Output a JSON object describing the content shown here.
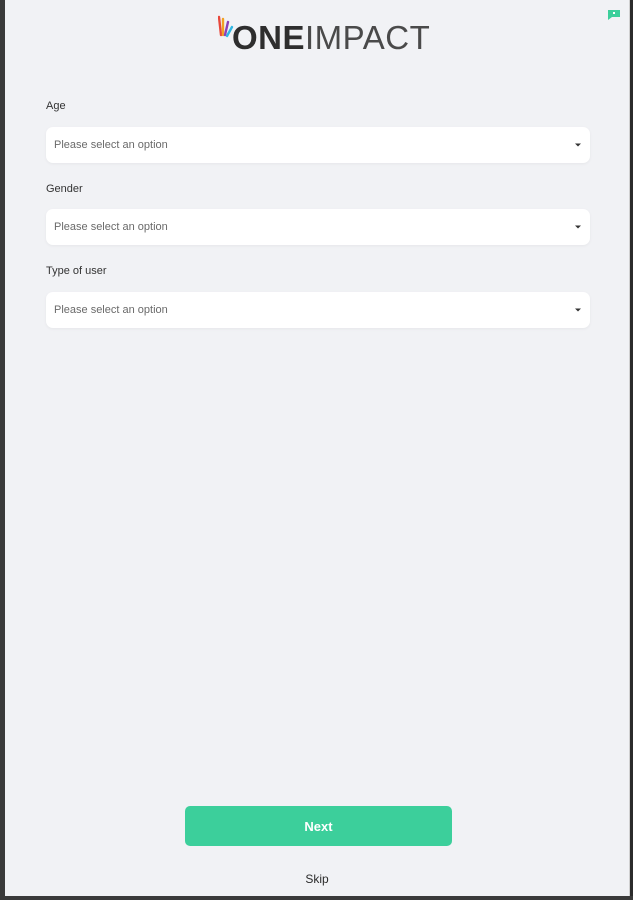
{
  "brand": {
    "logo_bold": "ONE",
    "logo_light": "IMPACT",
    "accent": "#3ccf9b"
  },
  "icons": {
    "logo_mark": "brand-feather-icon",
    "corner": "chat-flag-icon",
    "select_arrow": "caret-down-icon"
  },
  "form": {
    "fields": [
      {
        "label": "Age",
        "placeholder": "Please select an option"
      },
      {
        "label": "Gender",
        "placeholder": "Please select an option"
      },
      {
        "label": "Type of user",
        "placeholder": "Please select an option"
      }
    ]
  },
  "actions": {
    "next_label": "Next",
    "skip_label": "Skip"
  }
}
